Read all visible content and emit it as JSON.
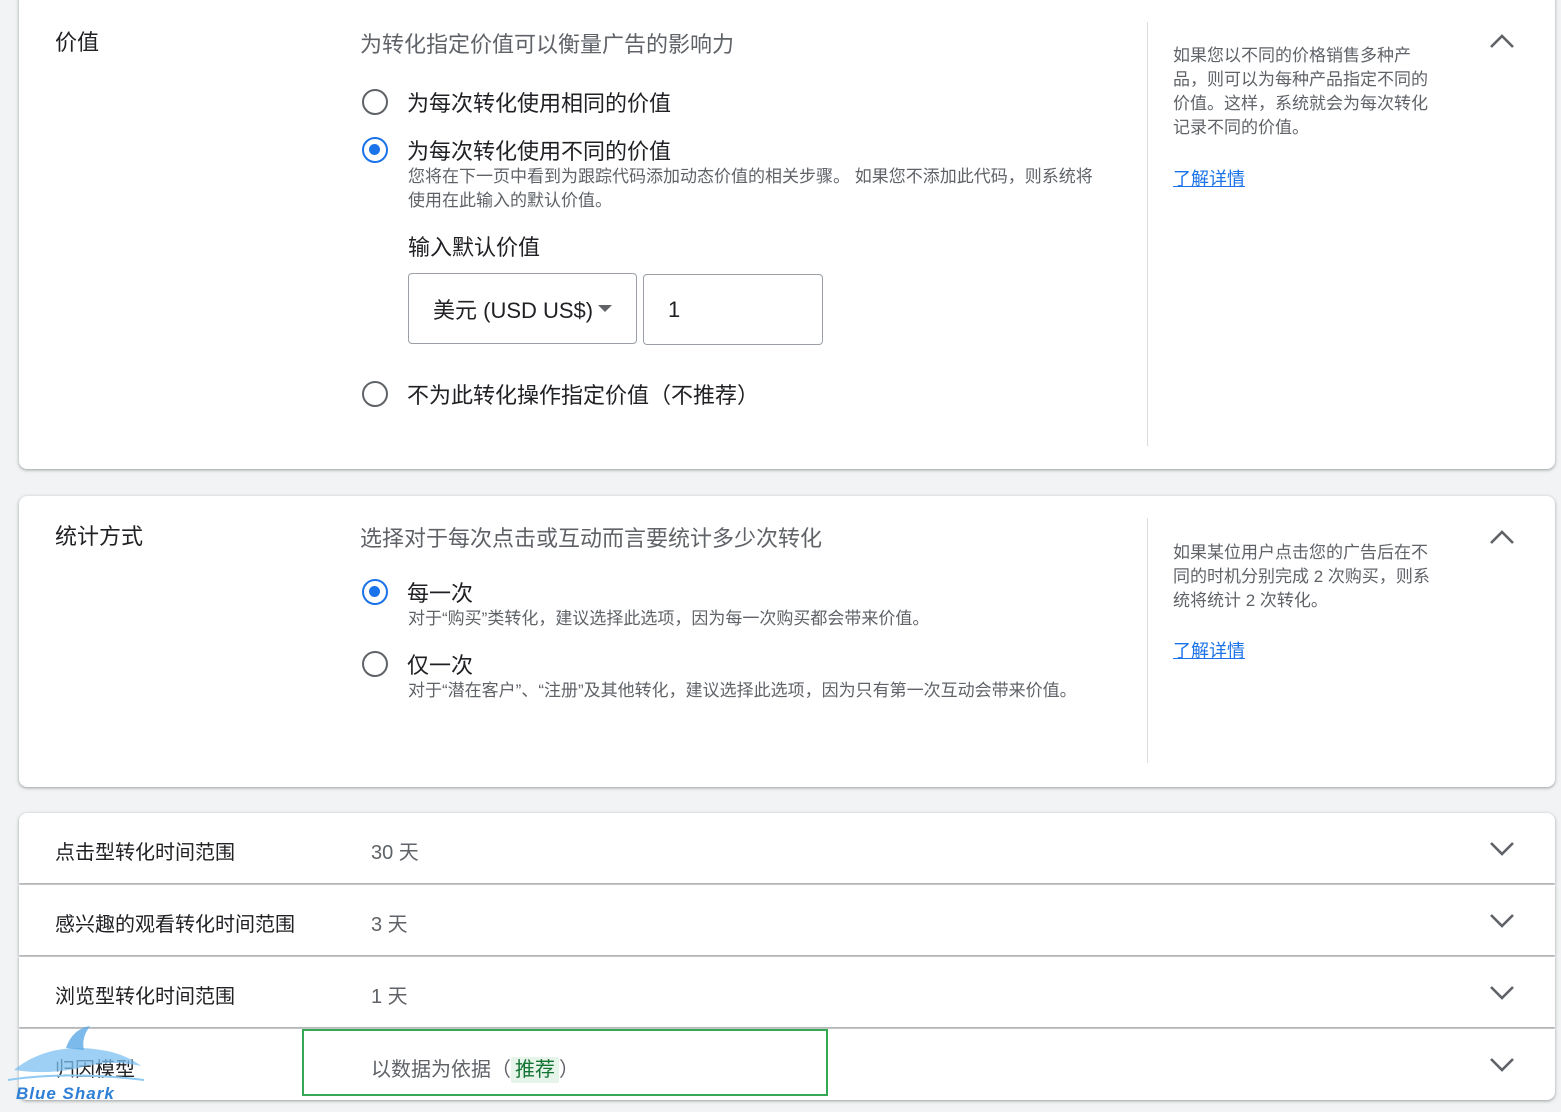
{
  "value_section": {
    "title": "价值",
    "description": "为转化指定价值可以衡量广告的影响力",
    "options": [
      {
        "label": "为每次转化使用相同的价值",
        "selected": false
      },
      {
        "label": "为每次转化使用不同的价值",
        "selected": true,
        "help": "您将在下一页中看到为跟踪代码添加动态价值的相关步骤。 如果您不添加此代码，则系统将使用在此输入的默认价值。"
      },
      {
        "label": "不为此转化操作指定价值（不推荐）",
        "selected": false
      }
    ],
    "default_value_label": "输入默认价值",
    "currency": "美元 (USD US$)",
    "default_value": "1",
    "side_help": "如果您以不同的价格销售多种产品，则可以为每种产品指定不同的价值。这样，系统就会为每次转化记录不同的价值。",
    "learn_more": "了解详情"
  },
  "count_section": {
    "title": "统计方式",
    "description": "选择对于每次点击或互动而言要统计多少次转化",
    "options": [
      {
        "label": "每一次",
        "selected": true,
        "help": "对于“购买”类转化，建议选择此选项，因为每一次购买都会带来价值。"
      },
      {
        "label": "仅一次",
        "selected": false,
        "help": "对于“潜在客户”、“注册”及其他转化，建议选择此选项，因为只有第一次互动会带来价值。"
      }
    ],
    "side_help": "如果某位用户点击您的广告后在不同的时机分别完成 2 次购买，则系统将统计 2 次转化。",
    "learn_more": "了解详情"
  },
  "collapsed_rows": [
    {
      "label": "点击型转化时间范围",
      "value": "30 天"
    },
    {
      "label": "感兴趣的观看转化时间范围",
      "value": "3 天"
    },
    {
      "label": "浏览型转化时间范围",
      "value": "1 天"
    },
    {
      "label": "归因模型",
      "value": "以数据为依据（",
      "badge": "推荐",
      "value_suffix": "）"
    }
  ],
  "watermark": {
    "text": "Blue Shark"
  },
  "colors": {
    "accent": "#1a73e8",
    "highlight": "#34a853",
    "badge_bg": "#e6f4ea"
  }
}
